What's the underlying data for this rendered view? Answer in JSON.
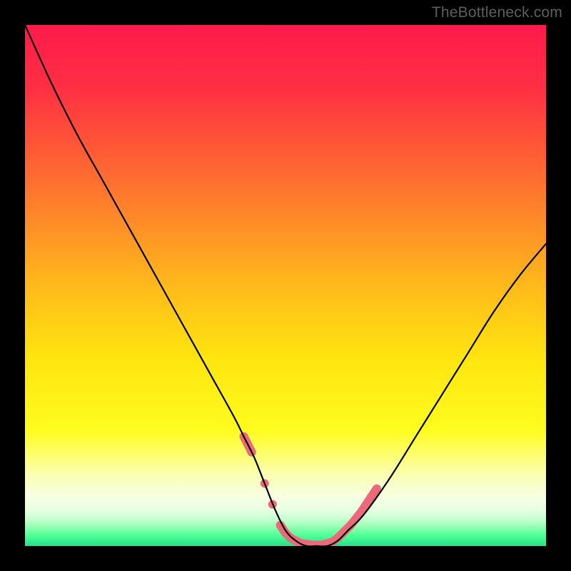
{
  "watermark": "TheBottleneck.com",
  "chart_data": {
    "type": "line",
    "title": "",
    "xlabel": "",
    "ylabel": "",
    "xlim": [
      0,
      100
    ],
    "ylim": [
      0,
      100
    ],
    "gradient_stops": [
      {
        "offset": 0.0,
        "color": "#ff1a4b"
      },
      {
        "offset": 0.12,
        "color": "#ff2f43"
      },
      {
        "offset": 0.3,
        "color": "#ff6f30"
      },
      {
        "offset": 0.5,
        "color": "#ffb91b"
      },
      {
        "offset": 0.64,
        "color": "#ffe50f"
      },
      {
        "offset": 0.78,
        "color": "#fffc20"
      },
      {
        "offset": 0.86,
        "color": "#fbffad"
      },
      {
        "offset": 0.905,
        "color": "#f7ffe2"
      },
      {
        "offset": 0.93,
        "color": "#e8ffe2"
      },
      {
        "offset": 0.95,
        "color": "#c3ffcf"
      },
      {
        "offset": 0.965,
        "color": "#8effae"
      },
      {
        "offset": 0.98,
        "color": "#4eff96"
      },
      {
        "offset": 1.0,
        "color": "#24e18a"
      }
    ],
    "series": [
      {
        "name": "bottleneck-curve",
        "x": [
          0,
          5,
          10,
          15,
          20,
          25,
          30,
          35,
          40,
          42,
          44,
          46,
          48,
          50,
          52,
          54,
          56,
          58,
          60,
          62,
          65,
          70,
          75,
          80,
          85,
          90,
          95,
          100
        ],
        "y": [
          100,
          89,
          79,
          70,
          61,
          52,
          43,
          34,
          25,
          21,
          17,
          12,
          7,
          3,
          1,
          0,
          0,
          0,
          1,
          3,
          6,
          13,
          21,
          29,
          37,
          45,
          52,
          58
        ]
      }
    ],
    "markers": {
      "name": "highlight-segments",
      "color": "#ea6a7a",
      "points": [
        {
          "x": 42.0,
          "y": 21.0
        },
        {
          "x": 43.5,
          "y": 18.0
        },
        {
          "x": 46.0,
          "y": 12.0
        },
        {
          "x": 47.5,
          "y": 8.0
        },
        {
          "x": 49.0,
          "y": 4.0
        },
        {
          "x": 50.0,
          "y": 2.5
        },
        {
          "x": 51.0,
          "y": 1.5
        },
        {
          "x": 53.0,
          "y": 0.5
        },
        {
          "x": 55.0,
          "y": 0.2
        },
        {
          "x": 57.0,
          "y": 0.2
        },
        {
          "x": 59.0,
          "y": 0.8
        },
        {
          "x": 60.0,
          "y": 1.5
        },
        {
          "x": 61.0,
          "y": 2.5
        },
        {
          "x": 62.5,
          "y": 4.0
        },
        {
          "x": 64.5,
          "y": 6.5
        },
        {
          "x": 65.5,
          "y": 8.0
        },
        {
          "x": 66.5,
          "y": 9.5
        },
        {
          "x": 67.5,
          "y": 11.0
        }
      ]
    }
  }
}
